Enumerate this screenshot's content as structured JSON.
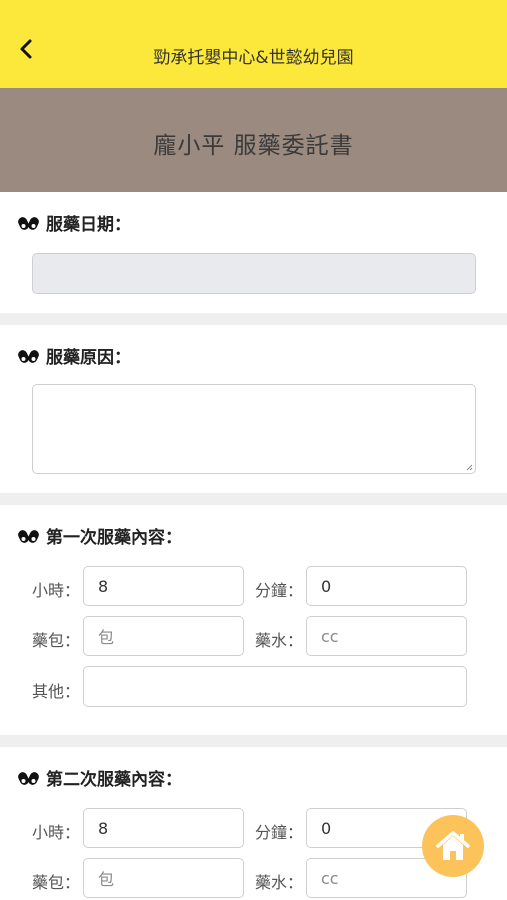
{
  "header": {
    "title": "勁承托嬰中心&世懿幼兒園",
    "back_icon": "chevron-left-icon"
  },
  "banner": {
    "title": "龐小平 服藥委託書"
  },
  "colors": {
    "topbar": "#fce83a",
    "banner": "#9b8a80",
    "fab": "#fcc35a"
  },
  "sections": {
    "date": {
      "label": "服藥日期：",
      "value": ""
    },
    "reason": {
      "label": "服藥原因：",
      "value": ""
    },
    "first": {
      "label": "第一次服藥內容：",
      "hour_label": "小時：",
      "hour_value": "8",
      "minute_label": "分鐘：",
      "minute_value": "0",
      "packet_label": "藥包：",
      "packet_placeholder": "包",
      "syrup_label": "藥水：",
      "syrup_placeholder": "cc",
      "other_label": "其他：",
      "other_value": ""
    },
    "second": {
      "label": "第二次服藥內容：",
      "hour_label": "小時：",
      "hour_value": "8",
      "minute_label": "分鐘：",
      "minute_value": "0",
      "packet_label": "藥包：",
      "packet_placeholder": "包",
      "syrup_label": "藥水：",
      "syrup_placeholder": "cc"
    }
  },
  "fab": {
    "icon": "home-icon"
  }
}
